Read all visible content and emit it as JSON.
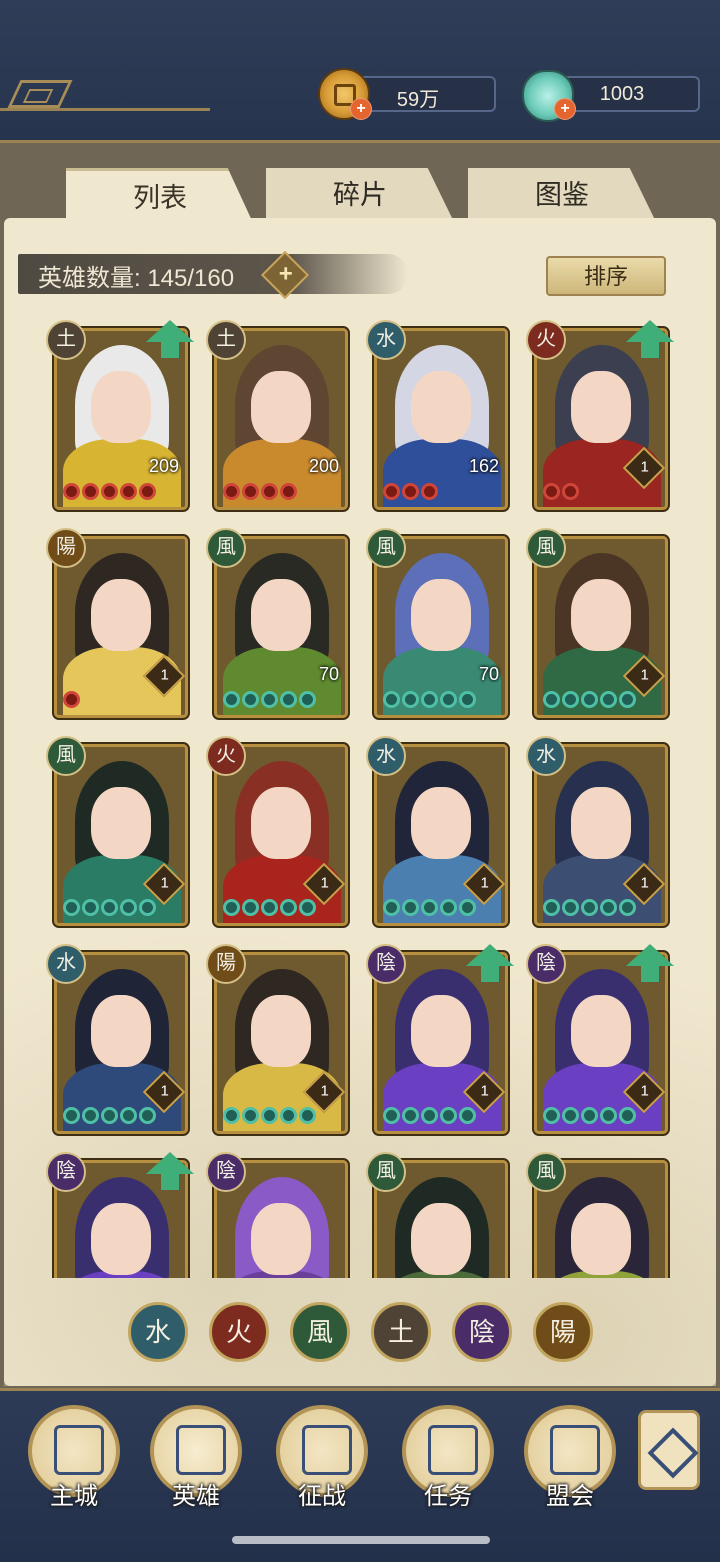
{
  "resources": {
    "coins": "59万",
    "jade": "1003"
  },
  "tabs": [
    "列表",
    "碎片",
    "图鉴"
  ],
  "hero_count": {
    "label": "英雄数量: 145/160",
    "add": "+"
  },
  "sort_label": "排序",
  "colors": {
    "water": "#2f5e6a",
    "fire": "#7d2a1f",
    "wind": "#2e5a3a",
    "earth": "#4e4334",
    "yin": "#4a2c68",
    "yang": "#6f4c18",
    "card_bg": "#6e5a2e",
    "star_red": "#d0453a",
    "star_green": "#4fc0a6"
  },
  "heroes": [
    {
      "element": "土",
      "elem_type": "earth",
      "level": "209",
      "stars": 5,
      "star_color": "red",
      "upgrade": true,
      "hair": "#e9e9e9",
      "body": "#d7b431"
    },
    {
      "element": "土",
      "elem_type": "earth",
      "level": "200",
      "stars": 4,
      "star_color": "red",
      "upgrade": false,
      "hair": "#5e4632",
      "body": "#c98a2e"
    },
    {
      "element": "水",
      "elem_type": "water",
      "level": "162",
      "stars": 3,
      "star_color": "red",
      "upgrade": false,
      "hair": "#d4d6e4",
      "body": "#2f4f9a"
    },
    {
      "element": "火",
      "elem_type": "fire",
      "level": "1",
      "stars": 2,
      "star_color": "red",
      "upgrade": true,
      "hair": "#3c3f4f",
      "body": "#9a2521"
    },
    {
      "element": "陽",
      "elem_type": "yang",
      "level": "1",
      "stars": 1,
      "star_color": "red",
      "upgrade": false,
      "hair": "#2f2722",
      "body": "#e5c65a"
    },
    {
      "element": "風",
      "elem_type": "wind",
      "level": "70",
      "stars": 5,
      "star_color": "green",
      "upgrade": false,
      "hair": "#2a2a24",
      "body": "#5f8a2f"
    },
    {
      "element": "風",
      "elem_type": "wind",
      "level": "70",
      "stars": 5,
      "star_color": "green",
      "upgrade": false,
      "hair": "#5c6fb8",
      "body": "#3a8a73"
    },
    {
      "element": "風",
      "elem_type": "wind",
      "level": "1",
      "stars": 5,
      "star_color": "green",
      "upgrade": false,
      "hair": "#4b3524",
      "body": "#2f6a44"
    },
    {
      "element": "風",
      "elem_type": "wind",
      "level": "1",
      "stars": 5,
      "star_color": "green",
      "upgrade": false,
      "hair": "#1f2a24",
      "body": "#2a7c64"
    },
    {
      "element": "火",
      "elem_type": "fire",
      "level": "1",
      "stars": 5,
      "star_color": "green",
      "upgrade": false,
      "hair": "#8a2f24",
      "body": "#a9241d"
    },
    {
      "element": "水",
      "elem_type": "water",
      "level": "1",
      "stars": 5,
      "star_color": "green",
      "upgrade": false,
      "hair": "#20253a",
      "body": "#4b7fb0"
    },
    {
      "element": "水",
      "elem_type": "water",
      "level": "1",
      "stars": 5,
      "star_color": "green",
      "upgrade": false,
      "hair": "#27314f",
      "body": "#3d4e73"
    },
    {
      "element": "水",
      "elem_type": "water",
      "level": "1",
      "stars": 5,
      "star_color": "green",
      "upgrade": false,
      "hair": "#1f2436",
      "body": "#2e4a7a"
    },
    {
      "element": "陽",
      "elem_type": "yang",
      "level": "1",
      "stars": 5,
      "star_color": "green",
      "upgrade": false,
      "hair": "#2f2722",
      "body": "#d9b946"
    },
    {
      "element": "陰",
      "elem_type": "yin",
      "level": "1",
      "stars": 5,
      "star_color": "green",
      "upgrade": true,
      "hair": "#3a2f6e",
      "body": "#6b3fc2"
    },
    {
      "element": "陰",
      "elem_type": "yin",
      "level": "1",
      "stars": 5,
      "star_color": "green",
      "upgrade": true,
      "hair": "#3a2f6e",
      "body": "#6b3fc2"
    },
    {
      "element": "陰",
      "elem_type": "yin",
      "level": "",
      "stars": 0,
      "star_color": "green",
      "upgrade": true,
      "hair": "#3a2f6e",
      "body": "#6b3fc2"
    },
    {
      "element": "陰",
      "elem_type": "yin",
      "level": "",
      "stars": 0,
      "star_color": "green",
      "upgrade": false,
      "hair": "#8a5ac7",
      "body": "#6a3f9a"
    },
    {
      "element": "風",
      "elem_type": "wind",
      "level": "",
      "stars": 0,
      "star_color": "green",
      "upgrade": false,
      "hair": "#1f2a24",
      "body": "#4b6b3a"
    },
    {
      "element": "風",
      "elem_type": "wind",
      "level": "",
      "stars": 0,
      "star_color": "green",
      "upgrade": false,
      "hair": "#2a2538",
      "body": "#8fa33a"
    }
  ],
  "filters": [
    {
      "glyph": "水",
      "elem_type": "water"
    },
    {
      "glyph": "火",
      "elem_type": "fire"
    },
    {
      "glyph": "風",
      "elem_type": "wind"
    },
    {
      "glyph": "土",
      "elem_type": "earth"
    },
    {
      "glyph": "陰",
      "elem_type": "yin"
    },
    {
      "glyph": "陽",
      "elem_type": "yang"
    }
  ],
  "nav": [
    "主城",
    "英雄",
    "征战",
    "任务",
    "盟会"
  ]
}
